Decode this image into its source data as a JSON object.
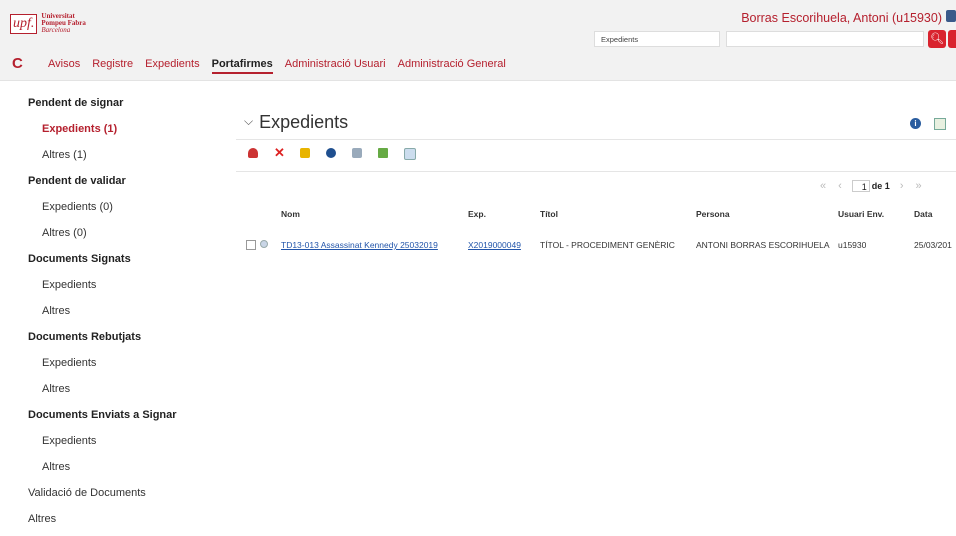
{
  "header": {
    "logo_mark": "upf.",
    "logo_line1": "Universitat",
    "logo_line2": "Pompeu Fabra",
    "logo_line3": "Barcelona",
    "user": "Borras Escorihuela, Antoni (u15930)",
    "search_type": "Expedients",
    "search_placeholder": ""
  },
  "nav": {
    "items": [
      "Avisos",
      "Registre",
      "Expedients",
      "Portafirmes",
      "Administració Usuari",
      "Administració General"
    ],
    "active": "Portafirmes"
  },
  "sidebar": {
    "groups": [
      {
        "title": "Pendent de signar",
        "items": [
          "Expedients (1)",
          "Altres (1)"
        ]
      },
      {
        "title": "Pendent de validar",
        "items": [
          "Expedients (0)",
          "Altres (0)"
        ]
      },
      {
        "title": "Documents Signats",
        "items": [
          "Expedients",
          "Altres"
        ]
      },
      {
        "title": "Documents Rebutjats",
        "items": [
          "Expedients",
          "Altres"
        ]
      },
      {
        "title": "Documents Enviats a Signar",
        "items": [
          "Expedients",
          "Altres"
        ]
      }
    ],
    "footer_items": [
      "Validació de Documents",
      "Altres"
    ]
  },
  "main": {
    "title": "Expedients",
    "pager": {
      "page": "1",
      "of_label": "de 1"
    },
    "columns": [
      "Nom",
      "Exp.",
      "Títol",
      "Persona",
      "Usuari Env.",
      "Data"
    ],
    "rows": [
      {
        "nom": "TD13-013 Assassinat Kennedy 25032019",
        "exp": "X2019000049",
        "titol": "TÍTOL - PROCEDIMENT GENÈRIC",
        "persona": "ANTONI BORRAS ESCORIHUELA",
        "usuari": "u15930",
        "data": "25/03/201"
      }
    ]
  },
  "colors": {
    "accent": "#b5202e",
    "link": "#2255aa"
  }
}
